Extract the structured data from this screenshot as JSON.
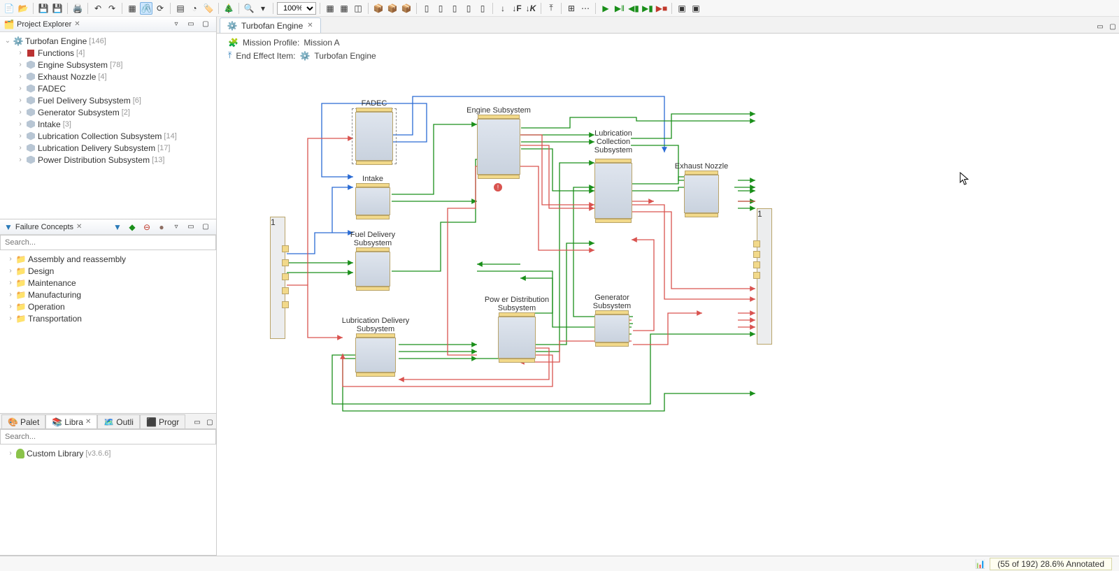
{
  "toolbar": {
    "zoom_value": "100%"
  },
  "editor": {
    "tab_title": "Turbofan Engine",
    "mission_profile_label": "Mission Profile:",
    "mission_profile_value": "Mission A",
    "end_effect_label": "End Effect Item:",
    "end_effect_value": "Turbofan Engine"
  },
  "project_explorer": {
    "title": "Project Explorer",
    "root": {
      "name": "Turbofan Engine",
      "count": "[146]"
    },
    "items": [
      {
        "name": "Functions",
        "count": "[4]",
        "type": "func"
      },
      {
        "name": "Engine Subsystem",
        "count": "[78]",
        "type": "cube"
      },
      {
        "name": "Exhaust Nozzle",
        "count": "[4]",
        "type": "cube"
      },
      {
        "name": "FADEC",
        "count": "",
        "type": "cube"
      },
      {
        "name": "Fuel Delivery Subsystem",
        "count": "[6]",
        "type": "cube"
      },
      {
        "name": "Generator Subsystem",
        "count": "[2]",
        "type": "cube"
      },
      {
        "name": "Intake",
        "count": "[3]",
        "type": "cube"
      },
      {
        "name": "Lubrication Collection Subsystem",
        "count": "[14]",
        "type": "cube"
      },
      {
        "name": "Lubrication Delivery Subsystem",
        "count": "[17]",
        "type": "cube"
      },
      {
        "name": "Power Distribution Subsystem",
        "count": "[13]",
        "type": "cube"
      }
    ]
  },
  "failure_concepts": {
    "title": "Failure Concepts",
    "search_placeholder": "Search...",
    "items": [
      {
        "name": "Assembly and reassembly"
      },
      {
        "name": "Design"
      },
      {
        "name": "Maintenance"
      },
      {
        "name": "Manufacturing"
      },
      {
        "name": "Operation"
      },
      {
        "name": "Transportation"
      }
    ]
  },
  "bottom_panel": {
    "tabs": [
      {
        "label": "Palet"
      },
      {
        "label": "Libra"
      },
      {
        "label": "Outli"
      },
      {
        "label": "Progr"
      }
    ],
    "search_placeholder": "Search...",
    "library": {
      "name": "Custom Library",
      "version": "[v3.6.6]"
    }
  },
  "diagram": {
    "left_port_label": "1",
    "right_port_label": "1",
    "blocks": {
      "fadec": "FADEC",
      "engine": "Engine Subsystem",
      "lub_col": "Lubrication\nCollection\nSubsystem",
      "intake": "Intake",
      "exhaust": "Exhaust Nozzle",
      "fuel": "Fuel Delivery\nSubsystem",
      "lub_del": "Lubrication Delivery\nSubsystem",
      "power": "Pow er Distribution\nSubsystem",
      "generator": "Generator\nSubsystem"
    }
  },
  "status": {
    "text": "(55 of 192) 28.6% Annotated"
  }
}
